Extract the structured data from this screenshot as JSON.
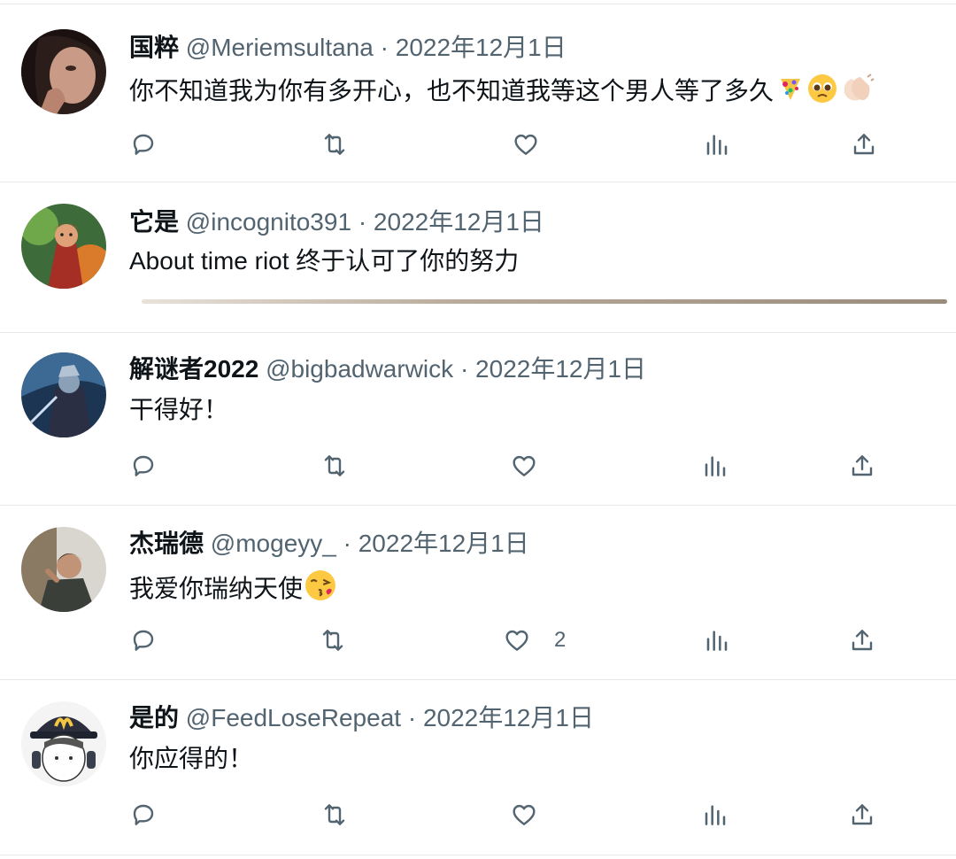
{
  "tweets": [
    {
      "name": "国粹",
      "handle": "@Meriemsultana",
      "separator": "·",
      "date": "2022年12月1日",
      "text": "你不知道我为你有多开心，也不知道我等这个男人等了多久",
      "emojis": [
        "confetti-emoji",
        "pleading-face-emoji",
        "clapping-hands-emoji"
      ],
      "likes": ""
    },
    {
      "name": "它是",
      "handle": "@incognito391",
      "separator": "·",
      "date": "2022年12月1日",
      "text": "About time riot 终于认可了你的努力",
      "emojis": [],
      "likes": ""
    },
    {
      "name": "解谜者2022",
      "handle": "@bigbadwarwick",
      "separator": "·",
      "date": "2022年12月1日",
      "text": "干得好！",
      "emojis": [],
      "likes": ""
    },
    {
      "name": "杰瑞德",
      "handle": "@mogeyy_",
      "separator": "·",
      "date": "2022年12月1日",
      "text": "我爱你瑞纳天使",
      "emojis": [
        "kissing-face-emoji"
      ],
      "likes": "2"
    },
    {
      "name": "是的",
      "handle": "@FeedLoseRepeat",
      "separator": "·",
      "date": "2022年12月1日",
      "text": "你应得的！",
      "emojis": [],
      "likes": ""
    }
  ],
  "icons": {
    "reply": "reply-icon",
    "retweet": "retweet-icon",
    "like": "like-icon",
    "views": "views-icon",
    "share": "share-icon"
  },
  "colors": {
    "text": "#0f1419",
    "secondary": "#536471",
    "border": "#e6e9ec"
  }
}
